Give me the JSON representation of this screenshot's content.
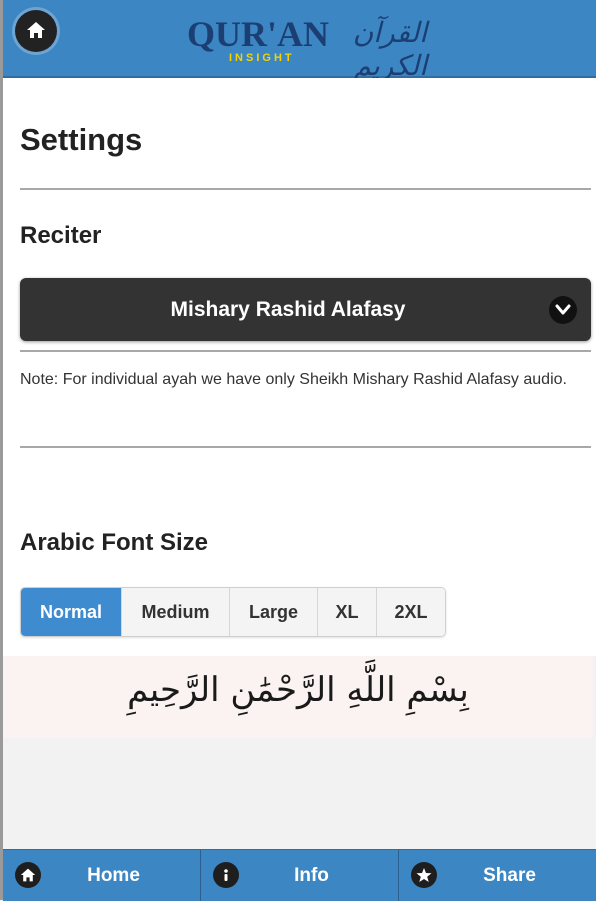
{
  "header": {
    "logo_text": "QUR'AN",
    "logo_subtext": "INSIGHT",
    "logo_arabic": "القرآن الكريم",
    "home_icon": "home-icon"
  },
  "page": {
    "title": "Settings"
  },
  "reciter": {
    "heading": "Reciter",
    "selected": "Mishary Rashid Alafasy",
    "dropdown_icon": "chevron-down-icon",
    "note": "Note: For individual ayah we have only Sheikh Mishary Rashid Alafasy audio."
  },
  "font_size": {
    "heading": "Arabic Font Size",
    "options": [
      "Normal",
      "Medium",
      "Large",
      "XL",
      "2XL"
    ],
    "selected": "Normal",
    "preview_text": "بِسْمِ اللَّهِ الرَّحْمَٰنِ الرَّحِيمِ"
  },
  "footer": {
    "items": [
      {
        "label": "Home",
        "icon": "home-icon"
      },
      {
        "label": "Info",
        "icon": "info-icon"
      },
      {
        "label": "Share",
        "icon": "star-icon"
      }
    ]
  },
  "colors": {
    "header_blue": "#3c86c3",
    "active_blue": "#3f8bd0",
    "select_dark": "#333333",
    "logo_navy": "#1c3f73",
    "logo_yellow": "#f4d400"
  }
}
